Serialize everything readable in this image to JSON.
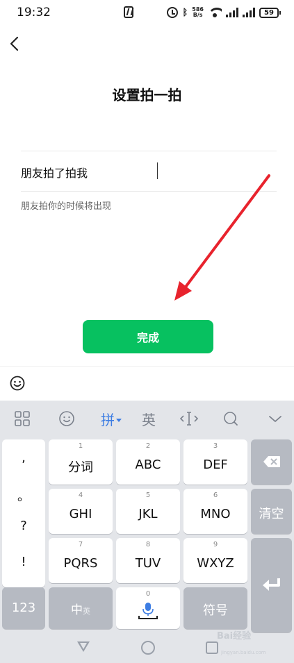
{
  "status_bar": {
    "time": "19:32",
    "net_speed_value": "586",
    "net_speed_unit": "B/s",
    "battery": "59"
  },
  "header": {
    "title": "设置拍一拍"
  },
  "pat_setting": {
    "prefix": "朋友拍了拍我",
    "hint": "朋友拍你的时候将出现"
  },
  "done_button": {
    "label": "完成",
    "color": "#07c160"
  },
  "keyboard": {
    "toolbar": {
      "pinyin_label": "拼",
      "english_label": "英"
    },
    "punctuation": [
      ",",
      "。",
      "?",
      "!"
    ],
    "keys": [
      {
        "num": "1",
        "label": "分词"
      },
      {
        "num": "2",
        "label": "ABC"
      },
      {
        "num": "3",
        "label": "DEF"
      },
      {
        "num": "4",
        "label": "GHI"
      },
      {
        "num": "5",
        "label": "JKL"
      },
      {
        "num": "6",
        "label": "MNO"
      },
      {
        "num": "7",
        "label": "PQRS"
      },
      {
        "num": "8",
        "label": "TUV"
      },
      {
        "num": "9",
        "label": "WXYZ"
      }
    ],
    "clear_label": "清空",
    "numbers_label": "123",
    "lang_main": "中",
    "lang_sub": "英",
    "space_num": "0",
    "symbols_label": "符号",
    "accent_color": "#3d7de3"
  },
  "watermark": {
    "text": "Bai经验",
    "sub": "jingyan.baidu.com"
  },
  "annotation_arrow_color": "#e8232d"
}
